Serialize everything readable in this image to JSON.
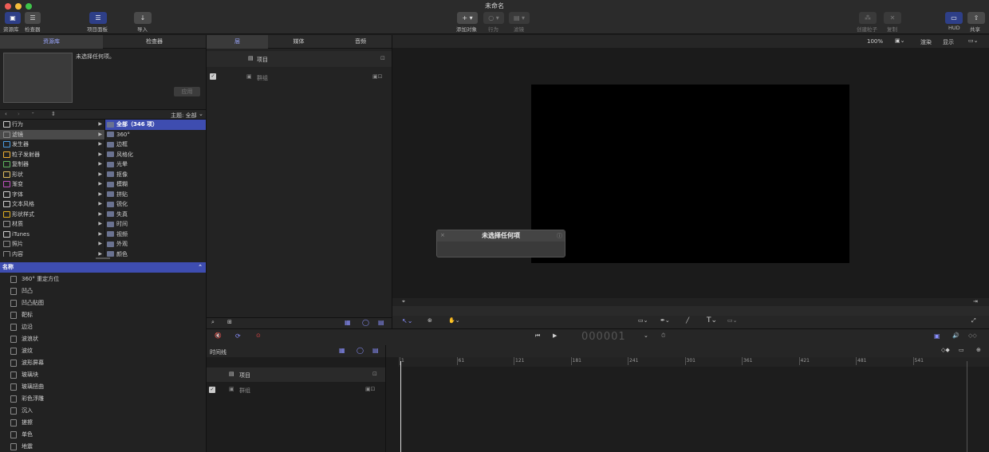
{
  "window": {
    "title": "未命名"
  },
  "toolbar": {
    "library": "资源库",
    "inspector": "检查器",
    "project_panel": "项目面板",
    "import": "导入",
    "add_object": "添加对象",
    "behaviors": "行为",
    "filters": "滤镜",
    "create_particles": "创建粒子",
    "replicate": "复制",
    "hud": "HUD",
    "share": "共享"
  },
  "left_tabs": {
    "library": "资源库",
    "inspector": "检查器"
  },
  "preview": {
    "no_selection": "未选择任何项。",
    "apply": "应用"
  },
  "browser": {
    "theme_label": "主题: 全部"
  },
  "categories": [
    {
      "label": "行为",
      "icon": "gear-icon"
    },
    {
      "label": "滤镜",
      "icon": "filter-icon"
    },
    {
      "label": "发生器",
      "icon": "generator-icon"
    },
    {
      "label": "粒子发射器",
      "icon": "particle-icon"
    },
    {
      "label": "复制器",
      "icon": "replicator-icon"
    },
    {
      "label": "形状",
      "icon": "shape-icon"
    },
    {
      "label": "渐变",
      "icon": "gradient-icon"
    },
    {
      "label": "字体",
      "icon": "font-icon"
    },
    {
      "label": "文本风格",
      "icon": "text-style-icon"
    },
    {
      "label": "形状样式",
      "icon": "shape-style-icon"
    },
    {
      "label": "材质",
      "icon": "material-icon"
    },
    {
      "label": "iTunes",
      "icon": "itunes-icon"
    },
    {
      "label": "照片",
      "icon": "photos-icon"
    },
    {
      "label": "内容",
      "icon": "content-icon"
    }
  ],
  "subcategories": [
    "全部（346 项）",
    "360°",
    "边框",
    "风格化",
    "光晕",
    "抠像",
    "模糊",
    "拼贴",
    "锐化",
    "失真",
    "时间",
    "视频",
    "外观",
    "颜色"
  ],
  "items_header": "名称",
  "items": [
    "360° 重定方位",
    "凹凸",
    "凹凸贴图",
    "靶标",
    "边沿",
    "波浪状",
    "波纹",
    "波形屏幕",
    "玻璃块",
    "玻璃扭曲",
    "彩色浮雕",
    "沉入",
    "搓擦",
    "单色",
    "地震"
  ],
  "layers_tabs": {
    "layers": "层",
    "media": "媒体",
    "audio": "音频"
  },
  "layers": {
    "project": "项目",
    "group": "群组"
  },
  "canvas_bar": {
    "zoom": "100%",
    "render": "渲染",
    "view": "显示"
  },
  "hud_panel": {
    "title": "未选择任何项"
  },
  "timeline": {
    "label": "时间线",
    "timecode": "000001",
    "project": "项目",
    "group": "群组"
  },
  "ruler": [
    "1",
    "61",
    "121",
    "181",
    "241",
    "301",
    "361",
    "421",
    "481",
    "541"
  ],
  "colors": {
    "accent": "#2e3f88",
    "selected_row": "#3e4db0",
    "canvas": "#000000"
  }
}
